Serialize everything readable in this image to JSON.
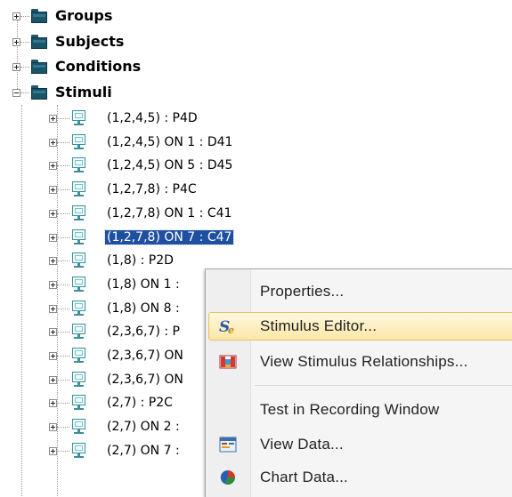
{
  "tree": {
    "groups": [
      {
        "label": "Groups",
        "state": "collapsed"
      },
      {
        "label": "Subjects",
        "state": "collapsed"
      },
      {
        "label": "Conditions",
        "state": "collapsed"
      },
      {
        "label": "Stimuli",
        "state": "expanded"
      }
    ],
    "stimuli": [
      {
        "label": "(1,2,4,5) : P4D"
      },
      {
        "label": "(1,2,4,5) ON 1 : D41"
      },
      {
        "label": "(1,2,4,5) ON 5 : D45"
      },
      {
        "label": "(1,2,7,8) : P4C"
      },
      {
        "label": "(1,2,7,8) ON 1 : C41"
      },
      {
        "label": "(1,2,7,8) ON 7 : C47",
        "selected": true
      },
      {
        "label": "(1,8) : P2D"
      },
      {
        "label": "(1,8) ON 1 :"
      },
      {
        "label": "(1,8) ON 8 :"
      },
      {
        "label": "(2,3,6,7) : P"
      },
      {
        "label": "(2,3,6,7) ON"
      },
      {
        "label": "(2,3,6,7) ON"
      },
      {
        "label": "(2,7) : P2C"
      },
      {
        "label": "(2,7) ON 2 :"
      },
      {
        "label": "(2,7) ON 7 :"
      }
    ]
  },
  "context_menu": {
    "items": [
      {
        "label": "Properties...",
        "icon": "none"
      },
      {
        "label": "Stimulus Editor...",
        "icon": "stimulus-editor-icon",
        "highlighted": true
      },
      {
        "label": "View Stimulus Relationships...",
        "icon": "relationships-icon"
      },
      {
        "label": "Test in Recording Window",
        "icon": "none"
      },
      {
        "label": "View Data...",
        "icon": "view-data-icon"
      },
      {
        "label": "Chart Data...",
        "icon": "chart-data-icon"
      }
    ]
  },
  "colors": {
    "selection": "#1e4fa0",
    "menu_highlight": "#fde7a8",
    "folder": "#1b5467",
    "monitor": "#3a8f9c"
  }
}
